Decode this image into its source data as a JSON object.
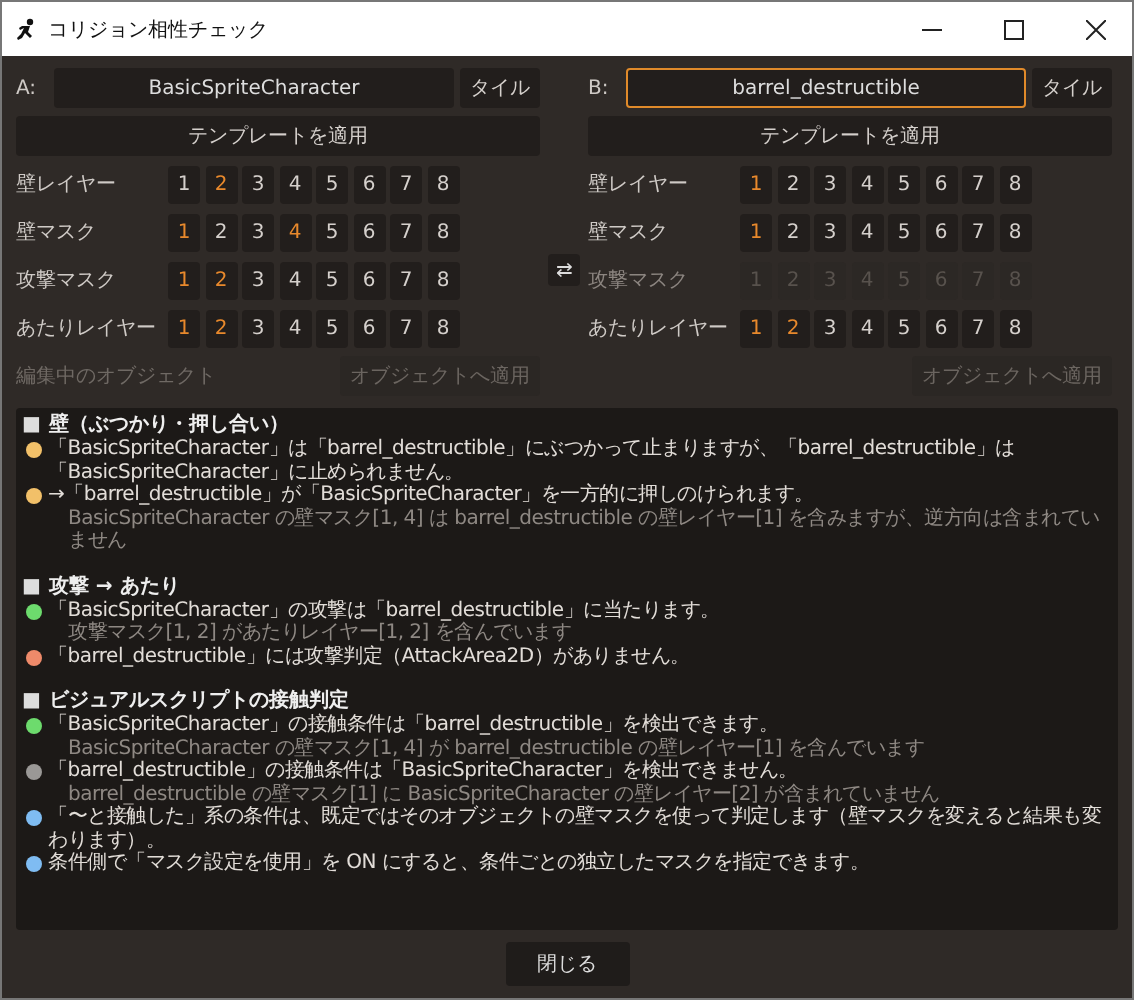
{
  "window": {
    "title": "コリジョン相性チェック"
  },
  "panels": [
    {
      "label": "A:",
      "object": "BasicSpriteCharacter",
      "focused": false,
      "tile_button": "タイル",
      "template_button": "テンプレートを適用",
      "rows": [
        {
          "label": "壁レイヤー",
          "disabled": false,
          "bits": [
            {
              "label": "1",
              "on": false
            },
            {
              "label": "2",
              "on": true
            },
            {
              "label": "3",
              "on": false
            },
            {
              "label": "4",
              "on": false
            },
            {
              "label": "5",
              "on": false
            },
            {
              "label": "6",
              "on": false
            },
            {
              "label": "7",
              "on": false
            },
            {
              "label": "8",
              "on": false
            }
          ]
        },
        {
          "label": "壁マスク",
          "disabled": false,
          "bits": [
            {
              "label": "1",
              "on": true
            },
            {
              "label": "2",
              "on": false
            },
            {
              "label": "3",
              "on": false
            },
            {
              "label": "4",
              "on": true
            },
            {
              "label": "5",
              "on": false
            },
            {
              "label": "6",
              "on": false
            },
            {
              "label": "7",
              "on": false
            },
            {
              "label": "8",
              "on": false
            }
          ]
        },
        {
          "label": "攻撃マスク",
          "disabled": false,
          "bits": [
            {
              "label": "1",
              "on": true
            },
            {
              "label": "2",
              "on": true
            },
            {
              "label": "3",
              "on": false
            },
            {
              "label": "4",
              "on": false
            },
            {
              "label": "5",
              "on": false
            },
            {
              "label": "6",
              "on": false
            },
            {
              "label": "7",
              "on": false
            },
            {
              "label": "8",
              "on": false
            }
          ]
        },
        {
          "label": "あたりレイヤー",
          "disabled": false,
          "bits": [
            {
              "label": "1",
              "on": true
            },
            {
              "label": "2",
              "on": true
            },
            {
              "label": "3",
              "on": false
            },
            {
              "label": "4",
              "on": false
            },
            {
              "label": "5",
              "on": false
            },
            {
              "label": "6",
              "on": false
            },
            {
              "label": "7",
              "on": false
            },
            {
              "label": "8",
              "on": false
            }
          ]
        }
      ],
      "status": "編集中のオブジェクト",
      "apply_button": {
        "label": "オブジェクトへ適用",
        "disabled": true
      }
    },
    {
      "label": "B:",
      "object": "barrel_destructible",
      "focused": true,
      "tile_button": "タイル",
      "template_button": "テンプレートを適用",
      "rows": [
        {
          "label": "壁レイヤー",
          "disabled": false,
          "bits": [
            {
              "label": "1",
              "on": true
            },
            {
              "label": "2",
              "on": false
            },
            {
              "label": "3",
              "on": false
            },
            {
              "label": "4",
              "on": false
            },
            {
              "label": "5",
              "on": false
            },
            {
              "label": "6",
              "on": false
            },
            {
              "label": "7",
              "on": false
            },
            {
              "label": "8",
              "on": false
            }
          ]
        },
        {
          "label": "壁マスク",
          "disabled": false,
          "bits": [
            {
              "label": "1",
              "on": true
            },
            {
              "label": "2",
              "on": false
            },
            {
              "label": "3",
              "on": false
            },
            {
              "label": "4",
              "on": false
            },
            {
              "label": "5",
              "on": false
            },
            {
              "label": "6",
              "on": false
            },
            {
              "label": "7",
              "on": false
            },
            {
              "label": "8",
              "on": false
            }
          ]
        },
        {
          "label": "攻撃マスク",
          "disabled": true,
          "bits": [
            {
              "label": "1",
              "on": false
            },
            {
              "label": "2",
              "on": false
            },
            {
              "label": "3",
              "on": false
            },
            {
              "label": "4",
              "on": false
            },
            {
              "label": "5",
              "on": false
            },
            {
              "label": "6",
              "on": false
            },
            {
              "label": "7",
              "on": false
            },
            {
              "label": "8",
              "on": false
            }
          ]
        },
        {
          "label": "あたりレイヤー",
          "disabled": false,
          "bits": [
            {
              "label": "1",
              "on": true
            },
            {
              "label": "2",
              "on": true
            },
            {
              "label": "3",
              "on": false
            },
            {
              "label": "4",
              "on": false
            },
            {
              "label": "5",
              "on": false
            },
            {
              "label": "6",
              "on": false
            },
            {
              "label": "7",
              "on": false
            },
            {
              "label": "8",
              "on": false
            }
          ]
        }
      ],
      "apply_button": {
        "label": "オブジェクトへ適用",
        "disabled": true
      }
    }
  ],
  "swap_button": "⇄",
  "results": [
    {
      "marker": "■",
      "heading": "壁（ぶつかり・押し合い）",
      "items": [
        {
          "color": "#f2c069",
          "text": "「BasicSpriteCharacter」は「barrel_destructible」にぶつかって止まりますが、「barrel_destructible」は「BasicSpriteCharacter」に止められません。"
        },
        {
          "color": "#f2c069",
          "text": "→「barrel_destructible」が「BasicSpriteCharacter」を一方的に押しのけられます。",
          "detail": "BasicSpriteCharacter の壁マスク[1, 4] は barrel_destructible の壁レイヤー[1] を含みますが、逆方向は含まれていません"
        }
      ]
    },
    {
      "marker": "■",
      "heading": "攻撃 → あたり",
      "items": [
        {
          "color": "#6ddb6d",
          "text": "「BasicSpriteCharacter」の攻撃は「barrel_destructible」に当たります。",
          "detail": "攻撃マスク[1, 2] があたりレイヤー[1, 2] を含んでいます"
        },
        {
          "color": "#ee8a6a",
          "text": "「barrel_destructible」には攻撃判定（AttackArea2D）がありません。"
        }
      ]
    },
    {
      "marker": "■",
      "heading": "ビジュアルスクリプトの接触判定",
      "items": [
        {
          "color": "#6ddb6d",
          "text": "「BasicSpriteCharacter」の接触条件は「barrel_destructible」を検出できます。",
          "detail": "BasicSpriteCharacter の壁マスク[1, 4] が barrel_destructible の壁レイヤー[1] を含んでいます"
        },
        {
          "color": "#9a9896",
          "text": "「barrel_destructible」の接触条件は「BasicSpriteCharacter」を検出できません。",
          "detail": "barrel_destructible の壁マスク[1] に BasicSpriteCharacter の壁レイヤー[2] が含まれていません"
        },
        {
          "color": "#7fbcf2",
          "text": "「〜と接触した」系の条件は、既定ではそのオブジェクトの壁マスクを使って判定します（壁マスクを変えると結果も変わります）。"
        },
        {
          "color": "#7fbcf2",
          "text": "条件側で「マスク設定を使用」を ON にすると、条件ごとの独立したマスクを指定できます。"
        }
      ]
    }
  ],
  "close_button": "閉じる"
}
